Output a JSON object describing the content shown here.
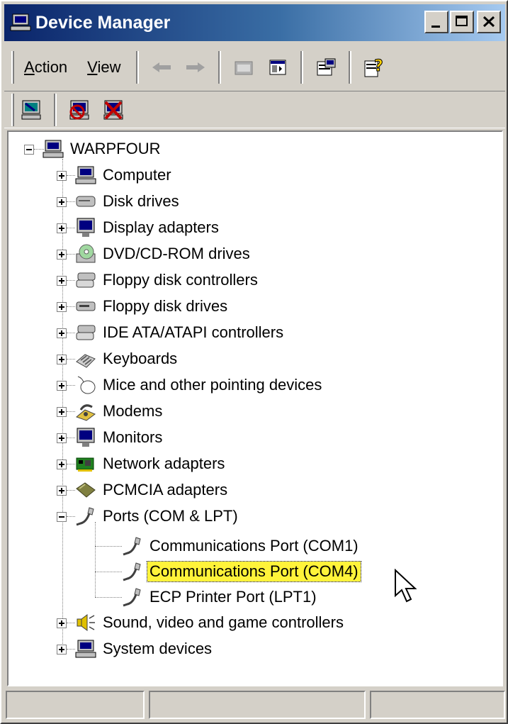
{
  "window": {
    "title": "Device Manager",
    "caption_buttons": [
      "minimize",
      "maximize",
      "close"
    ]
  },
  "menubar": {
    "items": [
      {
        "label": "Action",
        "mnemonic": "A"
      },
      {
        "label": "View",
        "mnemonic": "V"
      }
    ],
    "toolbar_icons": [
      "back-arrow-icon",
      "forward-arrow-icon",
      "up-folder-icon",
      "show-hide-tree-icon",
      "properties-icon",
      "help-icon"
    ]
  },
  "toolbar2": {
    "icons": [
      "scan-hardware-icon",
      "disable-device-icon",
      "uninstall-device-icon"
    ]
  },
  "tree": {
    "root": "WARPFOUR",
    "categories": [
      {
        "label": "Computer",
        "icon": "computer-icon",
        "expanded": false
      },
      {
        "label": "Disk drives",
        "icon": "disk-drive-icon",
        "expanded": false
      },
      {
        "label": "Display adapters",
        "icon": "display-adapter-icon",
        "expanded": false
      },
      {
        "label": "DVD/CD-ROM drives",
        "icon": "cdrom-icon",
        "expanded": false
      },
      {
        "label": "Floppy disk controllers",
        "icon": "controller-icon",
        "expanded": false
      },
      {
        "label": "Floppy disk drives",
        "icon": "floppy-drive-icon",
        "expanded": false
      },
      {
        "label": "IDE ATA/ATAPI controllers",
        "icon": "controller-icon",
        "expanded": false
      },
      {
        "label": "Keyboards",
        "icon": "keyboard-icon",
        "expanded": false
      },
      {
        "label": "Mice and other pointing devices",
        "icon": "mouse-icon",
        "expanded": false
      },
      {
        "label": "Modems",
        "icon": "modem-icon",
        "expanded": false
      },
      {
        "label": "Monitors",
        "icon": "monitor-icon",
        "expanded": false
      },
      {
        "label": "Network adapters",
        "icon": "network-adapter-icon",
        "expanded": false
      },
      {
        "label": "PCMCIA adapters",
        "icon": "pcmcia-icon",
        "expanded": false
      },
      {
        "label": "Ports (COM & LPT)",
        "icon": "port-icon",
        "expanded": true,
        "children": [
          {
            "label": "Communications Port (COM1)",
            "icon": "port-icon",
            "selected": false
          },
          {
            "label": "Communications Port (COM4)",
            "icon": "port-icon",
            "selected": true
          },
          {
            "label": "ECP Printer Port (LPT1)",
            "icon": "port-icon",
            "selected": false
          }
        ]
      },
      {
        "label": "Sound, video and game controllers",
        "icon": "speaker-icon",
        "expanded": false
      },
      {
        "label": "System devices",
        "icon": "computer-icon",
        "expanded": false
      }
    ]
  },
  "statusbar": {
    "cells": [
      "",
      "",
      ""
    ]
  },
  "colors": {
    "title_start": "#0a246a",
    "title_end": "#a6caf0",
    "face": "#d4d0c8",
    "selection": "#fff33a"
  }
}
